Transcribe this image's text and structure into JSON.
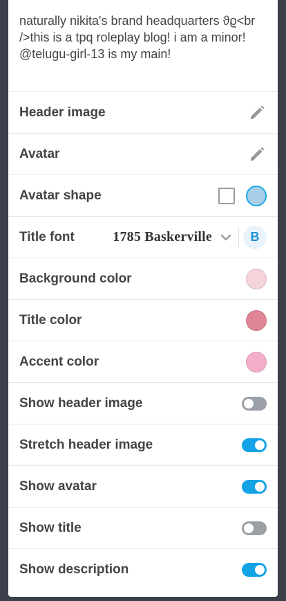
{
  "description": "naturally nikita's brand headquarters ϑϱ<br />this is a tpq roleplay blog! i am a minor! @telugu-girl-13 is my main!",
  "rows": {
    "header_image": {
      "label": "Header image",
      "icon": "pencil-icon"
    },
    "avatar": {
      "label": "Avatar",
      "icon": "pencil-icon"
    },
    "avatar_shape": {
      "label": "Avatar shape",
      "options": [
        "square",
        "circle"
      ],
      "selected": "circle"
    },
    "title_font": {
      "label": "Title font",
      "value": "1785 Baskerville",
      "bold_label": "B"
    },
    "background_color": {
      "label": "Background color",
      "color": "#f4d3db"
    },
    "title_color": {
      "label": "Title color",
      "color": "#df8594"
    },
    "accent_color": {
      "label": "Accent color",
      "color": "#f4aecb"
    },
    "show_header_image": {
      "label": "Show header image",
      "on": false
    },
    "stretch_header_image": {
      "label": "Stretch header image",
      "on": true
    },
    "show_avatar": {
      "label": "Show avatar",
      "on": true
    },
    "show_title": {
      "label": "Show title",
      "on": false
    },
    "show_description": {
      "label": "Show description",
      "on": true
    }
  }
}
